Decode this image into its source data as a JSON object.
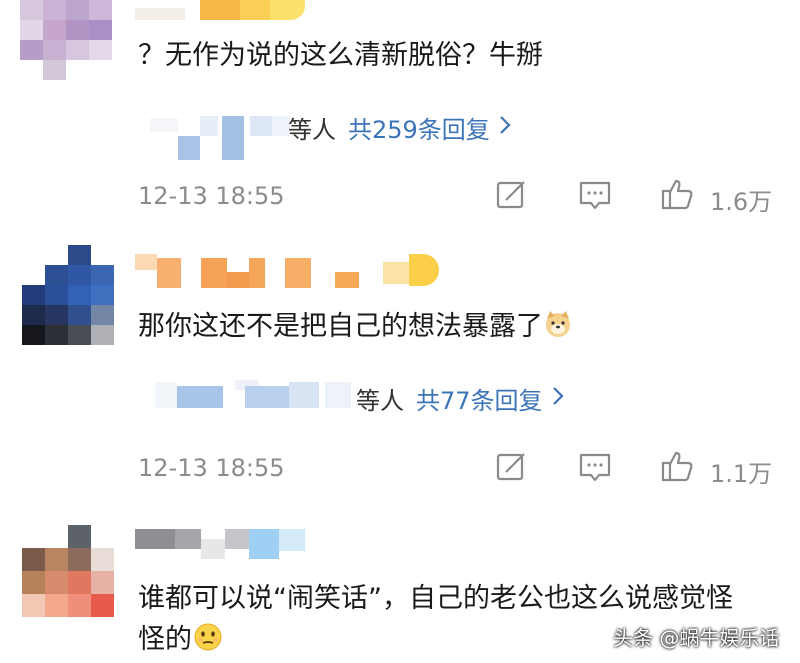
{
  "comments": [
    {
      "text": "？无作为说的这么清新脱俗？牛掰",
      "replies_who": "等人",
      "replies_count": "共259条回复",
      "timestamp": "12-13 18:55",
      "likes": "1.6万"
    },
    {
      "text": "那你这还不是把自己的想法暴露了",
      "replies_who": "等人",
      "replies_count": "共77条回复",
      "timestamp": "12-13 18:55",
      "likes": "1.1万"
    },
    {
      "text_line1": "谁都可以说“闹笑话”，自己的老公也这么说感觉怪",
      "text_line2": "怪的"
    }
  ],
  "icons": {
    "share": "share-edit-icon",
    "comment": "comment-icon",
    "like": "thumbs-up-icon",
    "chevron": "chevron-right-icon",
    "emoji_dog": "doge-emoji-icon",
    "emoji_face": "awkward-face-emoji-icon"
  },
  "watermark": "头条 @蜗牛娱乐话"
}
